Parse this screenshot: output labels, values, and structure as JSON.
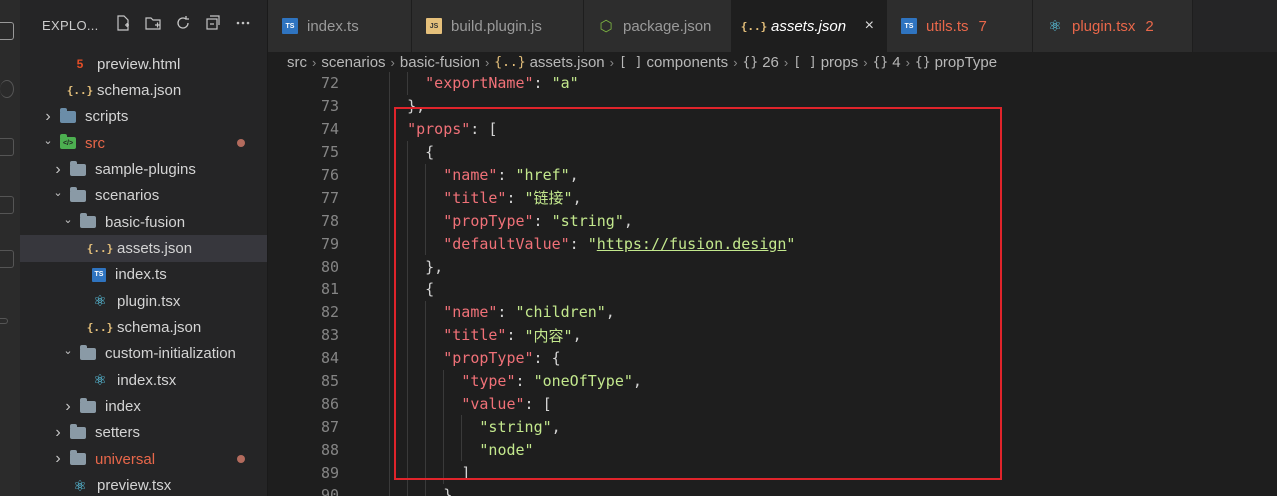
{
  "explorer": {
    "title": "EXPLO...",
    "actions": [
      "new-file-icon",
      "new-folder-icon",
      "refresh-icon",
      "collapse-icon",
      "more-icon"
    ],
    "items": [
      {
        "label": "preview.html",
        "icon": "html5-icon",
        "indent": 1,
        "chev": ""
      },
      {
        "label": "schema.json",
        "icon": "json-icon",
        "indent": 1,
        "chev": ""
      },
      {
        "label": "scripts",
        "icon": "folder-scripts-icon",
        "indent": 0,
        "chev": "right"
      },
      {
        "label": "src",
        "icon": "folder-src-icon",
        "indent": 0,
        "chev": "down",
        "modified": true
      },
      {
        "label": "sample-plugins",
        "icon": "folder-icon",
        "indent": 1,
        "chev": "right"
      },
      {
        "label": "scenarios",
        "icon": "folder-icon",
        "indent": 1,
        "chev": "down"
      },
      {
        "label": "basic-fusion",
        "icon": "folder-icon",
        "indent": 2,
        "chev": "down"
      },
      {
        "label": "assets.json",
        "icon": "json-icon",
        "indent": 3,
        "chev": "",
        "selected": true
      },
      {
        "label": "index.ts",
        "icon": "ts-icon",
        "indent": 3,
        "chev": ""
      },
      {
        "label": "plugin.tsx",
        "icon": "react-icon",
        "indent": 3,
        "chev": ""
      },
      {
        "label": "schema.json",
        "icon": "json-icon",
        "indent": 3,
        "chev": ""
      },
      {
        "label": "custom-initialization",
        "icon": "folder-icon",
        "indent": 2,
        "chev": "down"
      },
      {
        "label": "index.tsx",
        "icon": "react-icon",
        "indent": 3,
        "chev": ""
      },
      {
        "label": "index",
        "icon": "folder-icon",
        "indent": 2,
        "chev": "right"
      },
      {
        "label": "setters",
        "icon": "folder-icon",
        "indent": 1,
        "chev": "right"
      },
      {
        "label": "universal",
        "icon": "folder-icon",
        "indent": 1,
        "chev": "right",
        "modified": true
      },
      {
        "label": "preview.tsx",
        "icon": "react-icon",
        "indent": 1,
        "chev": ""
      }
    ]
  },
  "tabs": [
    {
      "label": "index.ts",
      "icon": "ts-icon"
    },
    {
      "label": "build.plugin.js",
      "icon": "js-icon"
    },
    {
      "label": "package.json",
      "icon": "node-icon"
    },
    {
      "label": "assets.json",
      "icon": "json-icon",
      "active": true,
      "close": "×"
    },
    {
      "label": "utils.ts",
      "icon": "ts-icon",
      "error": true,
      "count": "7"
    },
    {
      "label": "plugin.tsx",
      "icon": "react-icon",
      "error": true,
      "count": "2"
    }
  ],
  "breadcrumb": [
    {
      "label": "src"
    },
    {
      "label": "scenarios"
    },
    {
      "label": "basic-fusion"
    },
    {
      "label": "assets.json",
      "icon": "{..}"
    },
    {
      "label": "components",
      "icon": "[ ]"
    },
    {
      "label": "26",
      "icon": "{}"
    },
    {
      "label": "props",
      "icon": "[ ]"
    },
    {
      "label": "4",
      "icon": "{}"
    },
    {
      "label": "propType",
      "icon": "{}"
    }
  ],
  "code": [
    {
      "n": "72",
      "indent": 3,
      "tokens": [
        [
          "k",
          "\"exportName\""
        ],
        [
          "p",
          ": "
        ],
        [
          "s",
          "\"a\""
        ]
      ]
    },
    {
      "n": "73",
      "indent": 2,
      "tokens": [
        [
          "p",
          "},"
        ]
      ]
    },
    {
      "n": "74",
      "indent": 2,
      "tokens": [
        [
          "k",
          "\"props\""
        ],
        [
          "p",
          ": ["
        ]
      ]
    },
    {
      "n": "75",
      "indent": 3,
      "tokens": [
        [
          "p",
          "{"
        ]
      ]
    },
    {
      "n": "76",
      "indent": 4,
      "tokens": [
        [
          "k",
          "\"name\""
        ],
        [
          "p",
          ": "
        ],
        [
          "s",
          "\"href\""
        ],
        [
          "p",
          ","
        ]
      ]
    },
    {
      "n": "77",
      "indent": 4,
      "tokens": [
        [
          "k",
          "\"title\""
        ],
        [
          "p",
          ": "
        ],
        [
          "s",
          "\"链接\""
        ],
        [
          "p",
          ","
        ]
      ]
    },
    {
      "n": "78",
      "indent": 4,
      "tokens": [
        [
          "k",
          "\"propType\""
        ],
        [
          "p",
          ": "
        ],
        [
          "s",
          "\"string\""
        ],
        [
          "p",
          ","
        ]
      ]
    },
    {
      "n": "79",
      "indent": 4,
      "tokens": [
        [
          "k",
          "\"defaultValue\""
        ],
        [
          "p",
          ": "
        ],
        [
          "s",
          "\""
        ],
        [
          "u",
          "https://fusion.design"
        ],
        [
          "s",
          "\""
        ]
      ]
    },
    {
      "n": "80",
      "indent": 3,
      "tokens": [
        [
          "p",
          "},"
        ]
      ]
    },
    {
      "n": "81",
      "indent": 3,
      "tokens": [
        [
          "p",
          "{"
        ]
      ]
    },
    {
      "n": "82",
      "indent": 4,
      "tokens": [
        [
          "k",
          "\"name\""
        ],
        [
          "p",
          ": "
        ],
        [
          "s",
          "\"children\""
        ],
        [
          "p",
          ","
        ]
      ]
    },
    {
      "n": "83",
      "indent": 4,
      "tokens": [
        [
          "k",
          "\"title\""
        ],
        [
          "p",
          ": "
        ],
        [
          "s",
          "\"内容\""
        ],
        [
          "p",
          ","
        ]
      ]
    },
    {
      "n": "84",
      "indent": 4,
      "tokens": [
        [
          "k",
          "\"propType\""
        ],
        [
          "p",
          ": {"
        ]
      ]
    },
    {
      "n": "85",
      "indent": 5,
      "tokens": [
        [
          "k",
          "\"type\""
        ],
        [
          "p",
          ": "
        ],
        [
          "s",
          "\"oneOfType\""
        ],
        [
          "p",
          ","
        ]
      ]
    },
    {
      "n": "86",
      "indent": 5,
      "tokens": [
        [
          "k",
          "\"value\""
        ],
        [
          "p",
          ": ["
        ]
      ]
    },
    {
      "n": "87",
      "indent": 6,
      "tokens": [
        [
          "s",
          "\"string\""
        ],
        [
          "p",
          ","
        ]
      ]
    },
    {
      "n": "88",
      "indent": 6,
      "tokens": [
        [
          "s",
          "\"node\""
        ]
      ]
    },
    {
      "n": "89",
      "indent": 5,
      "tokens": [
        [
          "p",
          "]"
        ]
      ]
    },
    {
      "n": "90",
      "indent": 4,
      "tokens": [
        [
          "p",
          "}"
        ]
      ]
    }
  ],
  "colors": {
    "highlight_box": "#e0242b",
    "json_key": "#f07178",
    "json_string": "#c3e88d",
    "modified": "#e8674a"
  }
}
